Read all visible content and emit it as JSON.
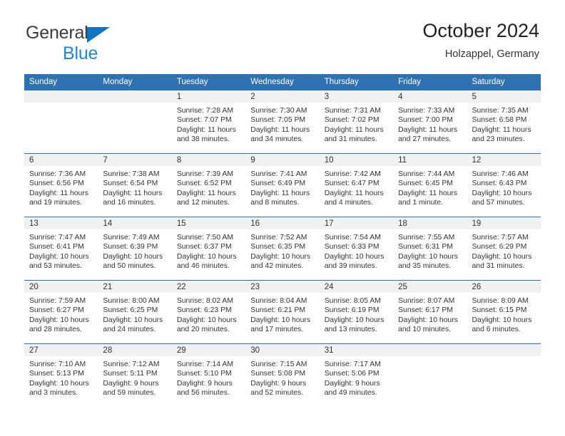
{
  "brand": {
    "name_part1": "General",
    "name_part2": "Blue",
    "logo_icon": "blue-triangle-logo"
  },
  "header": {
    "title": "October 2024",
    "location": "Holzappel, Germany"
  },
  "calendar": {
    "weekday_headers": [
      "Sunday",
      "Monday",
      "Tuesday",
      "Wednesday",
      "Thursday",
      "Friday",
      "Saturday"
    ],
    "accent_color": "#2e72b4",
    "daynum_band_color": "#f1f1f1",
    "weeks": [
      [
        {
          "day": "",
          "empty": true
        },
        {
          "day": "",
          "empty": true
        },
        {
          "day": "1",
          "sunrise": "Sunrise: 7:28 AM",
          "sunset": "Sunset: 7:07 PM",
          "daylight_line1": "Daylight: 11 hours",
          "daylight_line2": "and 38 minutes."
        },
        {
          "day": "2",
          "sunrise": "Sunrise: 7:30 AM",
          "sunset": "Sunset: 7:05 PM",
          "daylight_line1": "Daylight: 11 hours",
          "daylight_line2": "and 34 minutes."
        },
        {
          "day": "3",
          "sunrise": "Sunrise: 7:31 AM",
          "sunset": "Sunset: 7:02 PM",
          "daylight_line1": "Daylight: 11 hours",
          "daylight_line2": "and 31 minutes."
        },
        {
          "day": "4",
          "sunrise": "Sunrise: 7:33 AM",
          "sunset": "Sunset: 7:00 PM",
          "daylight_line1": "Daylight: 11 hours",
          "daylight_line2": "and 27 minutes."
        },
        {
          "day": "5",
          "sunrise": "Sunrise: 7:35 AM",
          "sunset": "Sunset: 6:58 PM",
          "daylight_line1": "Daylight: 11 hours",
          "daylight_line2": "and 23 minutes."
        }
      ],
      [
        {
          "day": "6",
          "sunrise": "Sunrise: 7:36 AM",
          "sunset": "Sunset: 6:56 PM",
          "daylight_line1": "Daylight: 11 hours",
          "daylight_line2": "and 19 minutes."
        },
        {
          "day": "7",
          "sunrise": "Sunrise: 7:38 AM",
          "sunset": "Sunset: 6:54 PM",
          "daylight_line1": "Daylight: 11 hours",
          "daylight_line2": "and 16 minutes."
        },
        {
          "day": "8",
          "sunrise": "Sunrise: 7:39 AM",
          "sunset": "Sunset: 6:52 PM",
          "daylight_line1": "Daylight: 11 hours",
          "daylight_line2": "and 12 minutes."
        },
        {
          "day": "9",
          "sunrise": "Sunrise: 7:41 AM",
          "sunset": "Sunset: 6:49 PM",
          "daylight_line1": "Daylight: 11 hours",
          "daylight_line2": "and 8 minutes."
        },
        {
          "day": "10",
          "sunrise": "Sunrise: 7:42 AM",
          "sunset": "Sunset: 6:47 PM",
          "daylight_line1": "Daylight: 11 hours",
          "daylight_line2": "and 4 minutes."
        },
        {
          "day": "11",
          "sunrise": "Sunrise: 7:44 AM",
          "sunset": "Sunset: 6:45 PM",
          "daylight_line1": "Daylight: 11 hours",
          "daylight_line2": "and 1 minute."
        },
        {
          "day": "12",
          "sunrise": "Sunrise: 7:46 AM",
          "sunset": "Sunset: 6:43 PM",
          "daylight_line1": "Daylight: 10 hours",
          "daylight_line2": "and 57 minutes."
        }
      ],
      [
        {
          "day": "13",
          "sunrise": "Sunrise: 7:47 AM",
          "sunset": "Sunset: 6:41 PM",
          "daylight_line1": "Daylight: 10 hours",
          "daylight_line2": "and 53 minutes."
        },
        {
          "day": "14",
          "sunrise": "Sunrise: 7:49 AM",
          "sunset": "Sunset: 6:39 PM",
          "daylight_line1": "Daylight: 10 hours",
          "daylight_line2": "and 50 minutes."
        },
        {
          "day": "15",
          "sunrise": "Sunrise: 7:50 AM",
          "sunset": "Sunset: 6:37 PM",
          "daylight_line1": "Daylight: 10 hours",
          "daylight_line2": "and 46 minutes."
        },
        {
          "day": "16",
          "sunrise": "Sunrise: 7:52 AM",
          "sunset": "Sunset: 6:35 PM",
          "daylight_line1": "Daylight: 10 hours",
          "daylight_line2": "and 42 minutes."
        },
        {
          "day": "17",
          "sunrise": "Sunrise: 7:54 AM",
          "sunset": "Sunset: 6:33 PM",
          "daylight_line1": "Daylight: 10 hours",
          "daylight_line2": "and 39 minutes."
        },
        {
          "day": "18",
          "sunrise": "Sunrise: 7:55 AM",
          "sunset": "Sunset: 6:31 PM",
          "daylight_line1": "Daylight: 10 hours",
          "daylight_line2": "and 35 minutes."
        },
        {
          "day": "19",
          "sunrise": "Sunrise: 7:57 AM",
          "sunset": "Sunset: 6:29 PM",
          "daylight_line1": "Daylight: 10 hours",
          "daylight_line2": "and 31 minutes."
        }
      ],
      [
        {
          "day": "20",
          "sunrise": "Sunrise: 7:59 AM",
          "sunset": "Sunset: 6:27 PM",
          "daylight_line1": "Daylight: 10 hours",
          "daylight_line2": "and 28 minutes."
        },
        {
          "day": "21",
          "sunrise": "Sunrise: 8:00 AM",
          "sunset": "Sunset: 6:25 PM",
          "daylight_line1": "Daylight: 10 hours",
          "daylight_line2": "and 24 minutes."
        },
        {
          "day": "22",
          "sunrise": "Sunrise: 8:02 AM",
          "sunset": "Sunset: 6:23 PM",
          "daylight_line1": "Daylight: 10 hours",
          "daylight_line2": "and 20 minutes."
        },
        {
          "day": "23",
          "sunrise": "Sunrise: 8:04 AM",
          "sunset": "Sunset: 6:21 PM",
          "daylight_line1": "Daylight: 10 hours",
          "daylight_line2": "and 17 minutes."
        },
        {
          "day": "24",
          "sunrise": "Sunrise: 8:05 AM",
          "sunset": "Sunset: 6:19 PM",
          "daylight_line1": "Daylight: 10 hours",
          "daylight_line2": "and 13 minutes."
        },
        {
          "day": "25",
          "sunrise": "Sunrise: 8:07 AM",
          "sunset": "Sunset: 6:17 PM",
          "daylight_line1": "Daylight: 10 hours",
          "daylight_line2": "and 10 minutes."
        },
        {
          "day": "26",
          "sunrise": "Sunrise: 8:09 AM",
          "sunset": "Sunset: 6:15 PM",
          "daylight_line1": "Daylight: 10 hours",
          "daylight_line2": "and 6 minutes."
        }
      ],
      [
        {
          "day": "27",
          "sunrise": "Sunrise: 7:10 AM",
          "sunset": "Sunset: 5:13 PM",
          "daylight_line1": "Daylight: 10 hours",
          "daylight_line2": "and 3 minutes."
        },
        {
          "day": "28",
          "sunrise": "Sunrise: 7:12 AM",
          "sunset": "Sunset: 5:11 PM",
          "daylight_line1": "Daylight: 9 hours",
          "daylight_line2": "and 59 minutes."
        },
        {
          "day": "29",
          "sunrise": "Sunrise: 7:14 AM",
          "sunset": "Sunset: 5:10 PM",
          "daylight_line1": "Daylight: 9 hours",
          "daylight_line2": "and 56 minutes."
        },
        {
          "day": "30",
          "sunrise": "Sunrise: 7:15 AM",
          "sunset": "Sunset: 5:08 PM",
          "daylight_line1": "Daylight: 9 hours",
          "daylight_line2": "and 52 minutes."
        },
        {
          "day": "31",
          "sunrise": "Sunrise: 7:17 AM",
          "sunset": "Sunset: 5:06 PM",
          "daylight_line1": "Daylight: 9 hours",
          "daylight_line2": "and 49 minutes."
        },
        {
          "day": "",
          "empty": true
        },
        {
          "day": "",
          "empty": true
        }
      ]
    ]
  }
}
